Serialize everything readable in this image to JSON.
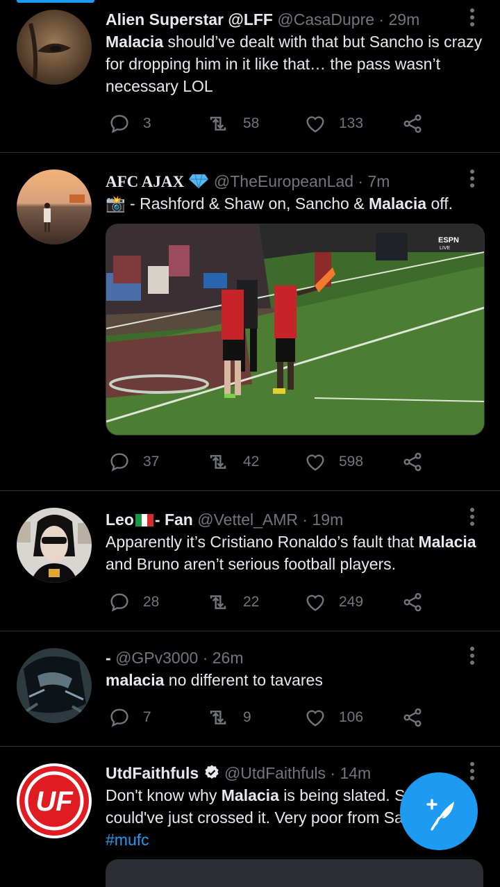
{
  "tweets": [
    {
      "name": "Alien Superstar @LFF",
      "handle": "@CasaDupre",
      "sep": " · ",
      "time": "29m",
      "text_bold": "Malacia",
      "text_rest": " should’ve dealt with that but Sancho is crazy for dropping him in it like that… the pass wasn’t necessary LOL",
      "replies": "3",
      "retweets": "58",
      "likes": "133"
    },
    {
      "name": "AFC AJAX",
      "handle": "@TheEuropeanLad",
      "sep": " · ",
      "time": "7m",
      "emoji": "📸",
      "text_pre": " - Rashford & Shaw on, Sancho & ",
      "text_bold": "Malacia",
      "text_post": " off.",
      "media_badge": "ESPN LIVE",
      "replies": "37",
      "retweets": "42",
      "likes": "598"
    },
    {
      "name_pre": "Leo",
      "name_post": "- Fan",
      "handle": "@Vettel_AMR",
      "sep": " · ",
      "time": "19m",
      "text_pre": "Apparently it’s Cristiano Ronaldo’s fault that ",
      "text_bold": "Malacia",
      "text_post": " and Bruno aren’t serious football players.",
      "replies": "28",
      "retweets": "22",
      "likes": "249"
    },
    {
      "name": "-",
      "handle": "@GPv3000",
      "sep": " · ",
      "time": "26m",
      "text_bold": "malacia",
      "text_rest": " no different to tavares",
      "replies": "7",
      "retweets": "9",
      "likes": "106"
    },
    {
      "name": "UtdFaithfuls",
      "handle": "@UtdFaithfuls",
      "sep": " · ",
      "time": "14m",
      "avatar_text": "UF",
      "text_pre": "Don't know why ",
      "text_bold": "Malacia",
      "text_mid": " is being slated. Sancho could've just crossed it. Very poor from Sancho.. ",
      "hashtag": "#mufc"
    }
  ],
  "colors": {
    "background": "#000000",
    "accent": "#1d9bf0",
    "muted": "#71767b",
    "text": "#e7e9ea",
    "divider": "#2f3336"
  },
  "icons": {
    "reply": "reply-icon",
    "retweet": "retweet-icon",
    "like": "heart-icon",
    "share": "share-icon",
    "more": "more-vertical-icon",
    "compose": "compose-tweet-icon"
  }
}
